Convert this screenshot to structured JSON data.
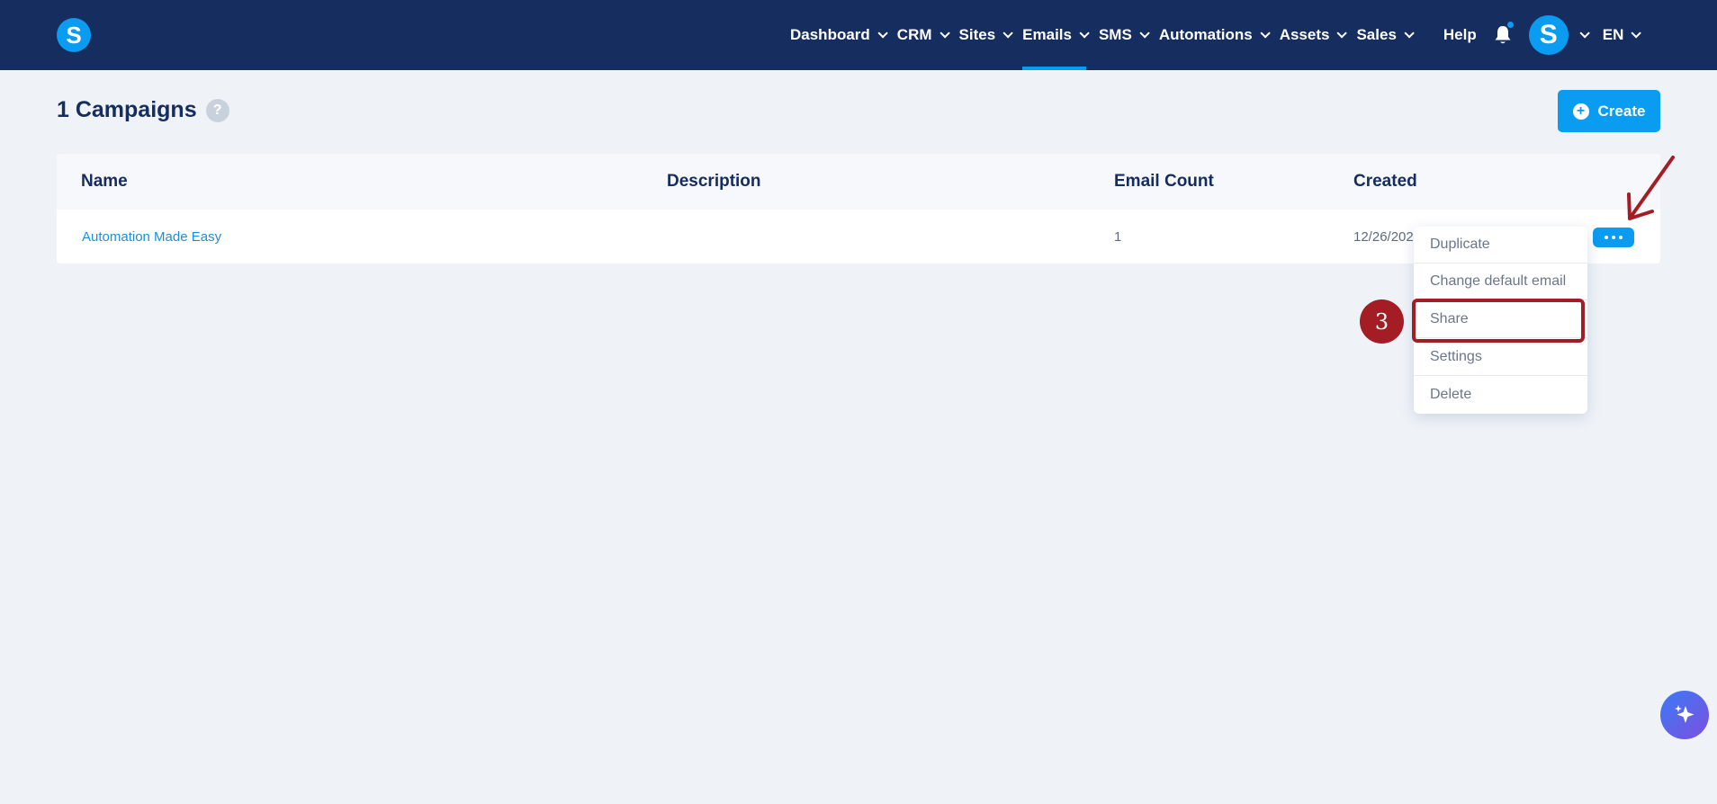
{
  "logo": {
    "letter": "S"
  },
  "nav": {
    "items": [
      {
        "label": "Dashboard",
        "has_dropdown": true,
        "active": false
      },
      {
        "label": "CRM",
        "has_dropdown": true,
        "active": false
      },
      {
        "label": "Sites",
        "has_dropdown": true,
        "active": false
      },
      {
        "label": "Emails",
        "has_dropdown": true,
        "active": true
      },
      {
        "label": "SMS",
        "has_dropdown": true,
        "active": false
      },
      {
        "label": "Automations",
        "has_dropdown": true,
        "active": false
      },
      {
        "label": "Assets",
        "has_dropdown": true,
        "active": false
      },
      {
        "label": "Sales",
        "has_dropdown": true,
        "active": false
      }
    ],
    "help_label": "Help",
    "avatar_letter": "S",
    "language": "EN"
  },
  "page": {
    "title": "1 Campaigns",
    "help_icon": "?",
    "create_label": "Create"
  },
  "table": {
    "columns": [
      "Name",
      "Description",
      "Email Count",
      "Created"
    ],
    "rows": [
      {
        "name": "Automation Made Easy",
        "description": "",
        "email_count": "1",
        "created": "12/26/202"
      }
    ]
  },
  "row_menu": {
    "items": [
      "Duplicate",
      "Change default email",
      "Share",
      "Settings",
      "Delete"
    ],
    "highlighted_item": "Share"
  },
  "annotation": {
    "step_number": "3"
  },
  "colors": {
    "topbar": "#162d60",
    "accent": "#0a9cf0",
    "annotation": "#a51d24",
    "background": "#eff3f8"
  }
}
